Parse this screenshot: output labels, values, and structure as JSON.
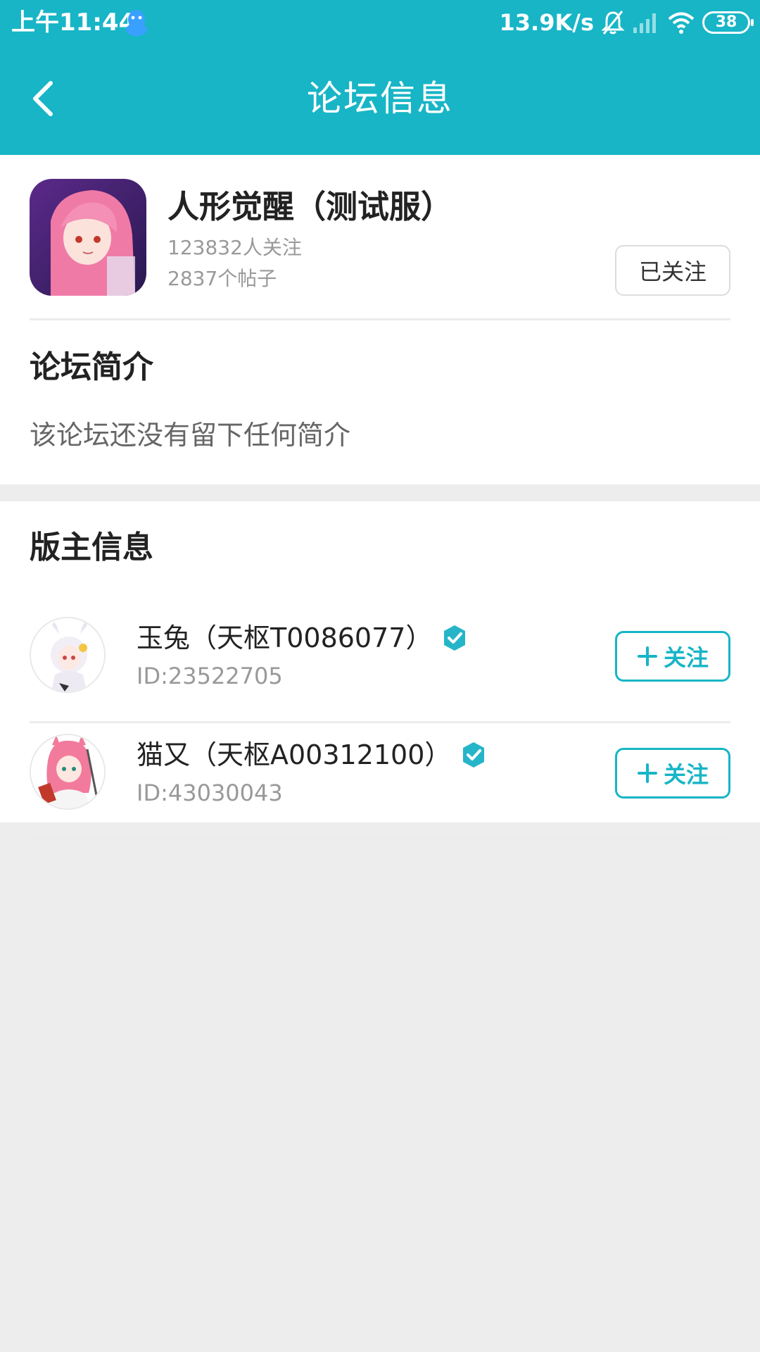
{
  "status_bar": {
    "time": "上午11:44",
    "network_speed": "13.9K/s",
    "battery": "38",
    "icons": [
      "qq-penguin-icon",
      "mute-bell-icon",
      "signal-icon",
      "wifi-icon",
      "battery-icon"
    ]
  },
  "header": {
    "title": "论坛信息",
    "back_icon": "chevron-left-icon"
  },
  "forum": {
    "name": "人形觉醒（测试服）",
    "followers": "123832人关注",
    "posts": "2837个帖子",
    "follow_state_label": "已关注"
  },
  "intro": {
    "heading": "论坛简介",
    "text": "该论坛还没有留下任何简介"
  },
  "moderators": {
    "heading": "版主信息",
    "items": [
      {
        "name": "玉兔（天枢T0086077）",
        "id": "ID:23522705",
        "follow_label": "关注"
      },
      {
        "name": "猫又（天枢A00312100）",
        "id": "ID:43030043",
        "follow_label": "关注"
      }
    ]
  },
  "colors": {
    "accent": "#17b5c6",
    "background": "#ededed",
    "card": "#ffffff"
  }
}
